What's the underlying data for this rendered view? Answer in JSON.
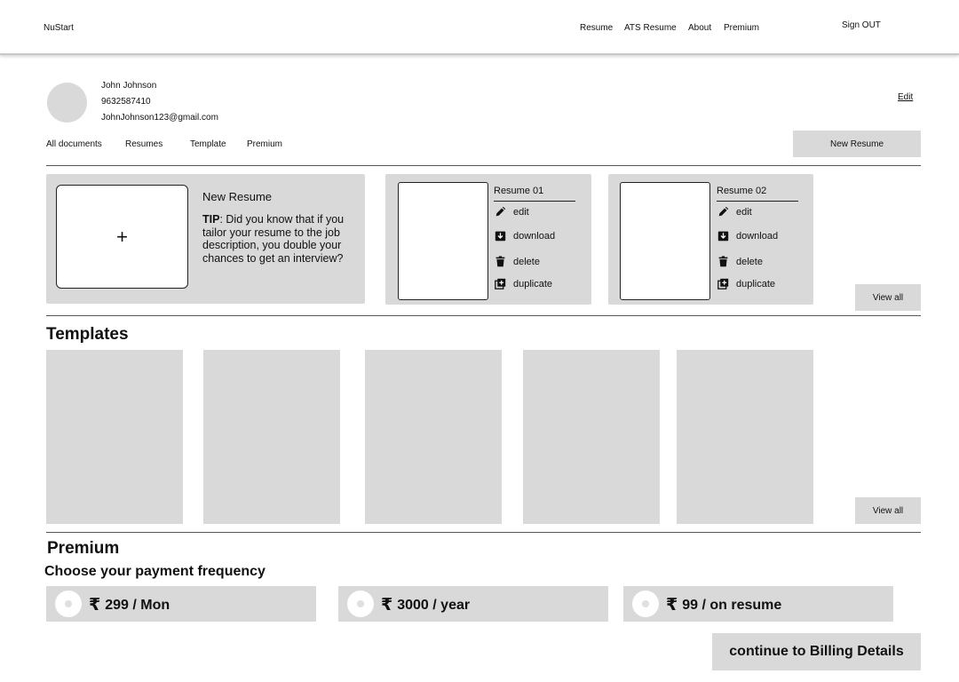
{
  "nav": {
    "brand": "NuStart",
    "links": [
      "Resume",
      "ATS Resume",
      "About",
      "Premium"
    ],
    "sign_out": "Sign OUT"
  },
  "profile": {
    "name": "John  Johnson",
    "phone": "9632587410",
    "email": "JohnJohnson123@gmail.com",
    "edit_label": "Edit"
  },
  "doc_tabs": [
    "All documents",
    "Resumes",
    "Template",
    "Premium"
  ],
  "new_resume_button": "New Resume",
  "new_card": {
    "plus": "+",
    "title": "New Resume",
    "tip_label": "TIP",
    "tip_text": ": Did you know that if you tailor your resume to the job description, you double your chances to get an interview?"
  },
  "resumes": [
    {
      "title": "Resume 01",
      "actions": [
        "edit",
        "download",
        "delete",
        "duplicate"
      ]
    },
    {
      "title": "Resume 02",
      "actions": [
        "edit",
        "download",
        "delete",
        "duplicate"
      ]
    }
  ],
  "view_all_label": "View all",
  "templates": {
    "title": "Templates",
    "count": 5,
    "view_all_label": "View all"
  },
  "premium": {
    "title": "Premium",
    "subtitle": "Choose your payment frequency",
    "currency_symbol": "₹",
    "plans": [
      "299 / Mon",
      "3000 / year",
      "99 / on resume"
    ],
    "continue_label": "continue to Billing Details"
  },
  "colors": {
    "panel_gray": "#d9d9d9",
    "line": "#555555",
    "text": "#111111"
  }
}
